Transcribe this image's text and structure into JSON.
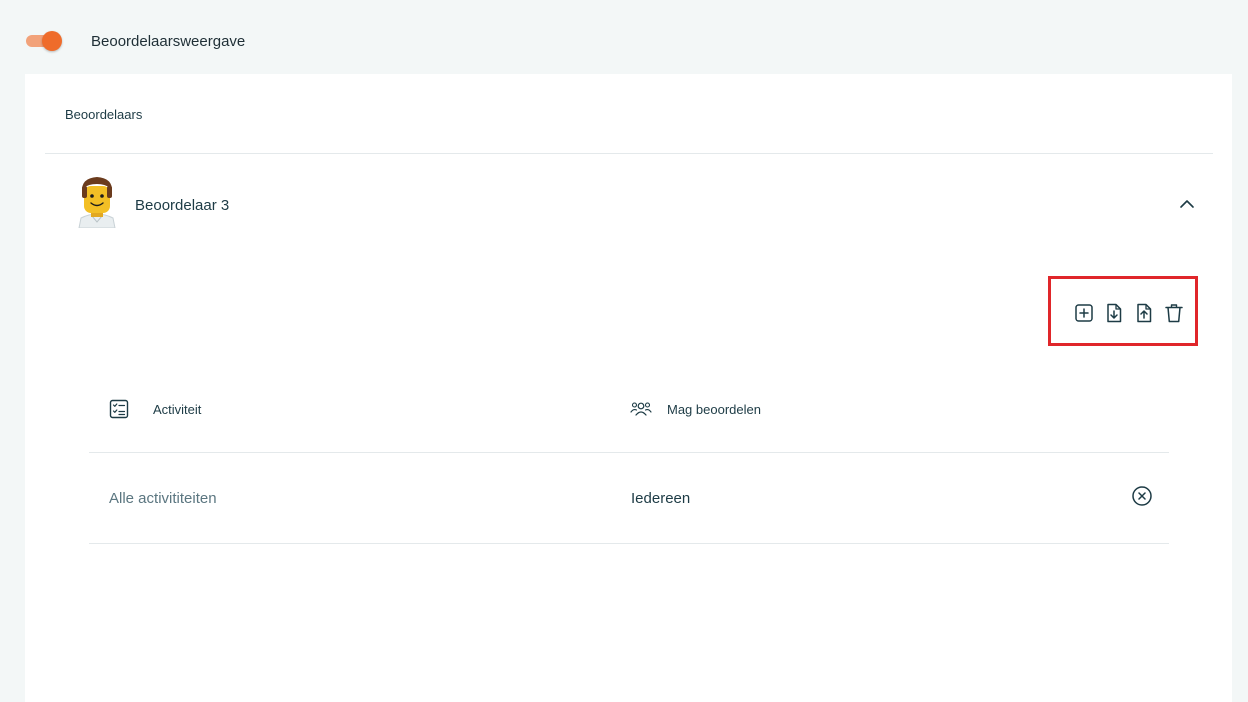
{
  "header": {
    "toggle_label": "Beoordelaarsweergave",
    "toggle_on": true
  },
  "section": {
    "title": "Beoordelaars"
  },
  "reviewer": {
    "name": "Beoordelaar 3",
    "expanded": true
  },
  "actions": [
    {
      "name": "add",
      "icon": "plus-square-icon"
    },
    {
      "name": "download",
      "icon": "file-download-icon"
    },
    {
      "name": "upload",
      "icon": "file-upload-icon"
    },
    {
      "name": "delete",
      "icon": "trash-icon"
    }
  ],
  "table": {
    "columns": [
      {
        "label": "Activiteit",
        "icon": "checklist-icon"
      },
      {
        "label": "Mag beoordelen",
        "icon": "users-icon"
      }
    ],
    "rows": [
      {
        "activity": "Alle activititeiten",
        "assessable": "Iedereen"
      }
    ]
  },
  "colors": {
    "accent": "#ef6c2b",
    "highlight_border": "#e0262a",
    "text": "#1d3b45"
  }
}
